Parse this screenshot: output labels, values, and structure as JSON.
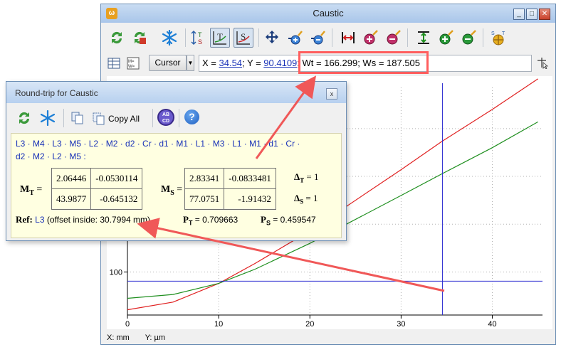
{
  "main_window": {
    "title": "Caustic",
    "app_icon": "ω",
    "controls": [
      "_",
      "□",
      "✕"
    ],
    "cursor_button": "Cursor",
    "coords": {
      "x_label": "X = ",
      "x_value": "34.54",
      "sep": "; Y = ",
      "y_value": "90.4109",
      "rest": "; Wt = 166.299; Ws = 187.505"
    },
    "status": {
      "x_unit": "X: mm",
      "y_unit": "Y: µm"
    }
  },
  "toolbar_icons": [
    "refresh-icon",
    "refresh-red-icon",
    "freeze-icon",
    "ts-swap-icon",
    "t-graph-icon",
    "s-graph-icon",
    "fit-all-icon",
    "zoom-in-x-icon",
    "zoom-out-x-icon",
    "fit-x-icon",
    "zoom-in-icon",
    "zoom-out-icon",
    "fit-y-icon",
    "zoom-in-y-icon",
    "zoom-out-y-icon",
    "ts-cursor-icon"
  ],
  "chart_data": {
    "type": "line",
    "xlabel": "",
    "ylabel": "",
    "xlim": [
      0,
      45.5
    ],
    "ylim": [
      55,
      293
    ],
    "x_ticks": [
      "0",
      "10",
      "20",
      "30",
      "40"
    ],
    "y_ticks": [
      "100"
    ],
    "grid": true,
    "series": [
      {
        "color": "#e02020",
        "x": [
          0,
          5,
          10,
          14,
          20,
          30,
          34.54,
          40,
          45
        ],
        "y": [
          60.5,
          68.5,
          88,
          109,
          143,
          207,
          237,
          270,
          302
        ]
      },
      {
        "color": "#1f8f1f",
        "x": [
          0,
          5,
          10,
          14,
          20,
          30,
          34.54,
          40,
          45
        ],
        "y": [
          72.5,
          76.5,
          88,
          103,
          130,
          180,
          203,
          230,
          257
        ]
      }
    ],
    "cursor": {
      "x": 34.54,
      "y": 90.4109
    }
  },
  "roundtrip": {
    "title": "Round-trip for Caustic",
    "close": "x",
    "copy_all": "Copy All",
    "abcd_icon": "AB CD",
    "sequence_line1": "L3 · M4 · L3 · M5 · L2 · M2 · d2 · Cr · d1 · M1 · L1 · M3 · L1 · M1 · d1 · Cr ·",
    "sequence_line2": "d2 · M2 · L2 · M5 :",
    "mt": {
      "label": "M",
      "sub": "T",
      "eq": " =",
      "a": "2.06446",
      "b": "-0.0530114",
      "c": "43.9877",
      "d": "-0.645132"
    },
    "ms": {
      "label": "M",
      "sub": "S",
      "eq": " =",
      "a": "2.83341",
      "b": "-0.0833481",
      "c": "77.0751",
      "d": "-1.91432"
    },
    "delta_t": {
      "sym": "Δ",
      "sub": "T",
      "val": " = 1"
    },
    "delta_s": {
      "sym": "Δ",
      "sub": "S",
      "val": " = 1"
    },
    "ref": {
      "label": "Ref:",
      "elem": "L3",
      "text": " (offset inside: 30.7994 mm)"
    },
    "pt": {
      "label": "P",
      "sub": "T",
      "val": " = 0.709663"
    },
    "ps": {
      "label": "P",
      "sub": "S",
      "val": " = 0.459547"
    }
  },
  "annotation": {
    "highlight_color": "#ff5e5e",
    "arrow_color": "#f05858"
  }
}
